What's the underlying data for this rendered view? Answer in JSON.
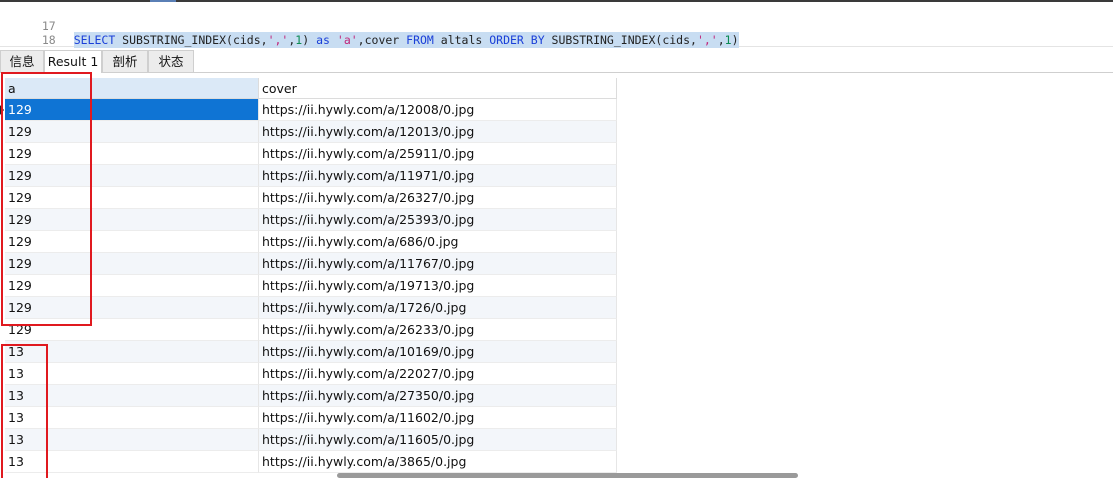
{
  "editor": {
    "lines": [
      {
        "number": "17"
      },
      {
        "number": "18",
        "code": [
          {
            "t": "kw",
            "v": "SELECT"
          },
          {
            "t": "plain",
            "v": " SUBSTRING_INDEX(cids,"
          },
          {
            "t": "str",
            "v": "','"
          },
          {
            "t": "plain",
            "v": ","
          },
          {
            "t": "num",
            "v": "1"
          },
          {
            "t": "plain",
            "v": ") "
          },
          {
            "t": "kw",
            "v": "as"
          },
          {
            "t": "plain",
            "v": " "
          },
          {
            "t": "str",
            "v": "'a'"
          },
          {
            "t": "plain",
            "v": ",cover "
          },
          {
            "t": "kw",
            "v": "FROM"
          },
          {
            "t": "plain",
            "v": " altals "
          },
          {
            "t": "kw",
            "v": "ORDER BY"
          },
          {
            "t": "plain",
            "v": " SUBSTRING_INDEX(cids,"
          },
          {
            "t": "str",
            "v": "','"
          },
          {
            "t": "plain",
            "v": ","
          },
          {
            "t": "num",
            "v": "1"
          },
          {
            "t": "plain",
            "v": ")"
          }
        ]
      }
    ]
  },
  "tabs": [
    {
      "label": "信息",
      "active": false
    },
    {
      "label": "Result 1",
      "active": true
    },
    {
      "label": "剖析",
      "active": false
    },
    {
      "label": "状态",
      "active": false
    }
  ],
  "grid": {
    "columns": [
      "a",
      "cover"
    ],
    "rows": [
      [
        "129",
        "https://ii.hywly.com/a/12008/0.jpg"
      ],
      [
        "129",
        "https://ii.hywly.com/a/12013/0.jpg"
      ],
      [
        "129",
        "https://ii.hywly.com/a/25911/0.jpg"
      ],
      [
        "129",
        "https://ii.hywly.com/a/11971/0.jpg"
      ],
      [
        "129",
        "https://ii.hywly.com/a/26327/0.jpg"
      ],
      [
        "129",
        "https://ii.hywly.com/a/25393/0.jpg"
      ],
      [
        "129",
        "https://ii.hywly.com/a/686/0.jpg"
      ],
      [
        "129",
        "https://ii.hywly.com/a/11767/0.jpg"
      ],
      [
        "129",
        "https://ii.hywly.com/a/19713/0.jpg"
      ],
      [
        "129",
        "https://ii.hywly.com/a/1726/0.jpg"
      ],
      [
        "129",
        "https://ii.hywly.com/a/26233/0.jpg"
      ],
      [
        "13",
        "https://ii.hywly.com/a/10169/0.jpg"
      ],
      [
        "13",
        "https://ii.hywly.com/a/22027/0.jpg"
      ],
      [
        "13",
        "https://ii.hywly.com/a/27350/0.jpg"
      ],
      [
        "13",
        "https://ii.hywly.com/a/11602/0.jpg"
      ],
      [
        "13",
        "https://ii.hywly.com/a/11605/0.jpg"
      ],
      [
        "13",
        "https://ii.hywly.com/a/3865/0.jpg"
      ]
    ],
    "selected_row": 0
  },
  "colors": {
    "selection": "#0f74d4",
    "annotation_box": "#e0191f",
    "header_selected": "#dbe9f7",
    "keyword": "#1a3fd8",
    "string": "#c0267a",
    "number": "#0a8a52"
  }
}
